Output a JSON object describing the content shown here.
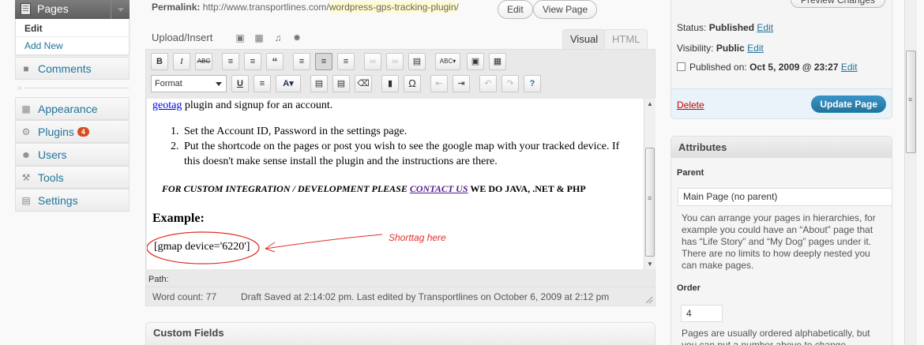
{
  "sidebar": {
    "pages_label": "Pages",
    "submenu": {
      "edit": "Edit",
      "add_new": "Add New"
    },
    "items": [
      {
        "label": "Comments",
        "icon": "comment-icon"
      },
      {
        "label": "Appearance",
        "icon": "appearance-icon"
      },
      {
        "label": "Plugins",
        "icon": "plugin-icon",
        "badge": "4"
      },
      {
        "label": "Users",
        "icon": "users-icon"
      },
      {
        "label": "Tools",
        "icon": "tools-icon"
      },
      {
        "label": "Settings",
        "icon": "settings-icon"
      }
    ]
  },
  "permalink": {
    "label": "Permalink:",
    "base": "http://www.transportlines.com/",
    "slug": "wordpress-gps-tracking-plugin",
    "trail": "/",
    "edit_button": "Edit",
    "view_button": "View Page"
  },
  "editor": {
    "upload_label": "Upload/Insert",
    "tab_visual": "Visual",
    "tab_html": "HTML",
    "format_label": "Format",
    "content": {
      "line1_link": "geotag",
      "line1_rest": " plugin and signup for an account.",
      "list": [
        {
          "num": "1.",
          "text": "Set the Account ID, Password in the settings page."
        },
        {
          "num": "2.",
          "text": "Put the shortcode on the pages or post you wish to see the google map with your tracked device. If this doesn't make sense install the plugin and the instructions are there."
        }
      ],
      "custom_before": "FOR CUSTOM INTEGRATION / DEVELOPMENT PLEASE ",
      "custom_link": "CONTACT US",
      "custom_after": " WE DO JAVA, .NET & PHP",
      "example_heading": "Example:",
      "shortcode": "[gmap device='6220']",
      "annotation": "Shorttag here"
    },
    "path_label": "Path:",
    "word_count": "Word count: 77",
    "draft_status": "Draft Saved at 2:14:02 pm. Last edited by Transportlines on October 6, 2009 at 2:12 pm"
  },
  "custom_fields_title": "Custom Fields",
  "publish": {
    "preview_button": "Preview Changes",
    "status_label": "Status:",
    "status_value": "Published",
    "visibility_label": "Visibility:",
    "visibility_value": "Public",
    "published_label": "Published on:",
    "published_value": "Oct 5, 2009 @ 23:27",
    "edit_link": "Edit",
    "delete_link": "Delete",
    "update_button": "Update Page"
  },
  "attributes": {
    "title": "Attributes",
    "parent_label": "Parent",
    "parent_value": "Main Page (no parent)",
    "parent_help": "You can arrange your pages in hierarchies, for example you could have an “About” page that has “Life Story” and “My Dog” pages under it. There are no limits to how deeply nested you can make pages.",
    "order_label": "Order",
    "order_value": "4",
    "order_help": "Pages are usually ordered alphabetically, but you can put a number above to change"
  },
  "colors": {
    "link": "#21759b",
    "annotation": "#e0302a",
    "update_button": "#21759b",
    "badge": "#d54e21"
  }
}
